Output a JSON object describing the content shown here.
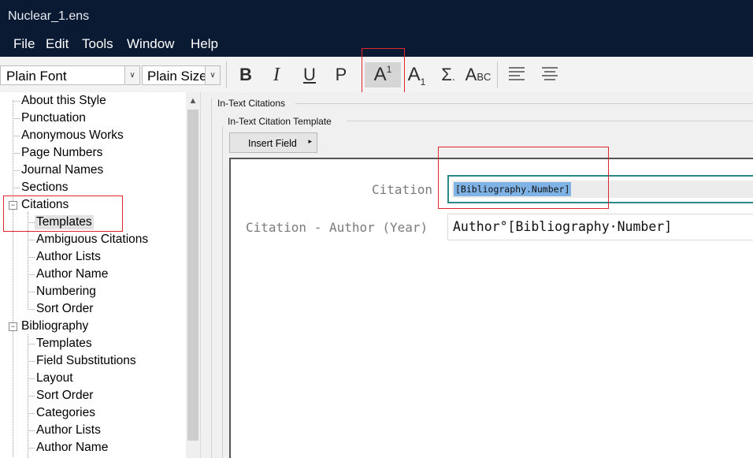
{
  "window": {
    "title": "Nuclear_1.ens"
  },
  "menu": [
    "File",
    "Edit",
    "Tools",
    "Window",
    "Help"
  ],
  "toolbar": {
    "font": "Plain Font",
    "size": "Plain Size",
    "bold": "B",
    "italic": "I",
    "underline": "U",
    "plain": "P",
    "superscript_base": "A",
    "superscript_mark": "1",
    "subscript_base": "A",
    "subscript_mark": "1",
    "symbol": "Σ",
    "symbol_dot": ".",
    "smallcaps_big": "A",
    "smallcaps_small": "BC",
    "smallcaps_cap_b": "b"
  },
  "tree": {
    "items": [
      "About this Style",
      "Punctuation",
      "Anonymous Works",
      "Page Numbers",
      "Journal Names",
      "Sections",
      "Citations",
      "Templates",
      "Ambiguous Citations",
      "Author Lists",
      "Author Name",
      "Numbering",
      "Sort Order",
      "Bibliography",
      "Templates",
      "Field Substitutions",
      "Layout",
      "Sort Order",
      "Categories",
      "Author Lists",
      "Author Name"
    ],
    "expander_symbol": "−",
    "selected": "Templates"
  },
  "panel": {
    "group_title": "In-Text Citations",
    "subgroup_title": "In-Text Citation Template",
    "insert_field": "Insert Field",
    "insert_arrow": "▸",
    "fields": [
      {
        "label": "Citation",
        "value": "[Bibliography.Number]"
      },
      {
        "label": "Citation - Author (Year)",
        "value": "Author°[Bibliography·Number]"
      }
    ]
  },
  "scroll_up_arrow": "▲",
  "combo_arrow": "∨"
}
